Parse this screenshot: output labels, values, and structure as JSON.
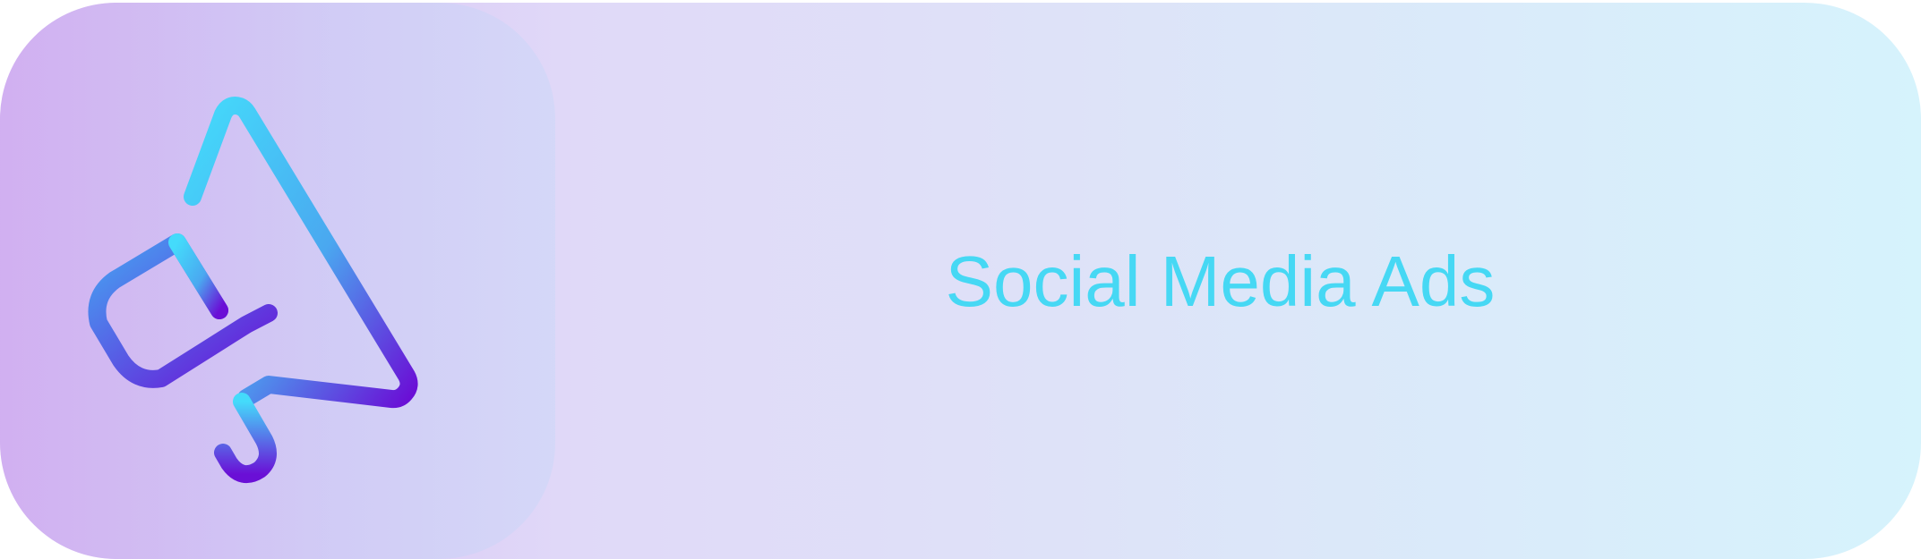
{
  "button": {
    "label": "Social Media Ads",
    "icon": "megaphone-icon"
  },
  "colors": {
    "text": "#46d8f4",
    "icon_gradient_start": "#44dbfb",
    "icon_gradient_end": "#6a0fd6",
    "background_start": "#d6b6f2",
    "background_end": "#d6f3fc"
  }
}
